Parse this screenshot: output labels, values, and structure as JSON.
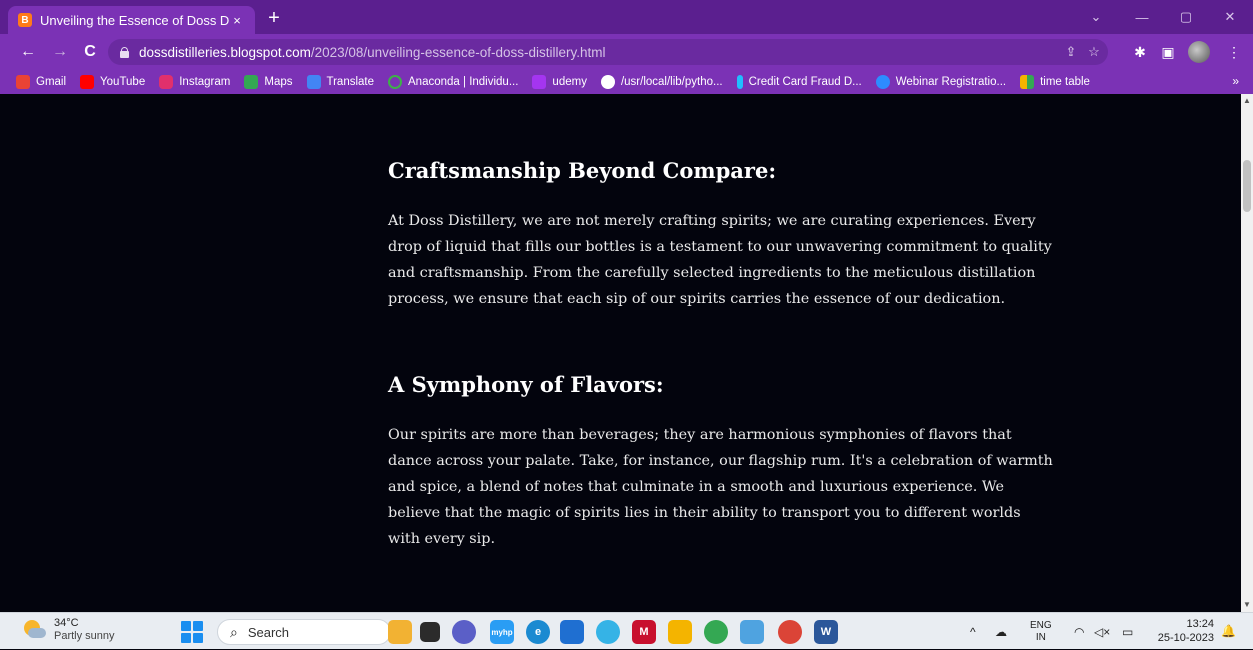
{
  "browser": {
    "tab": {
      "title": "Unveiling the Essence of Doss D",
      "favicon": "B",
      "close": "×"
    },
    "new_tab": "+",
    "window_controls": {
      "dropdown": "⌄",
      "minimize": "—",
      "restore": "▢",
      "close": "✕"
    },
    "nav": {
      "back": "←",
      "forward": "→",
      "reload": "C"
    },
    "url": {
      "host": "dossdistilleries.blogspot.com",
      "path": "/2023/08/unveiling-essence-of-doss-distillery.html"
    },
    "omnibox_icons": {
      "share": "⇪",
      "star": "☆"
    },
    "extensions": {
      "puzzle": "✱",
      "sidepanel": "▣",
      "menu": "⋮"
    },
    "bookmarks": [
      {
        "label": "Gmail",
        "color": "#ea4335"
      },
      {
        "label": "YouTube",
        "color": "#ff0000"
      },
      {
        "label": "Instagram",
        "color": "#e1306c"
      },
      {
        "label": "Maps",
        "color": "#34a853"
      },
      {
        "label": "Translate",
        "color": "#4285f4"
      },
      {
        "label": "Anaconda | Individu...",
        "color": "#3eb049"
      },
      {
        "label": "udemy",
        "color": "#a435f0"
      },
      {
        "label": "/usr/local/lib/pytho...",
        "color": "#ffffff"
      },
      {
        "label": "Credit Card Fraud D...",
        "color": "#20beff"
      },
      {
        "label": "Webinar Registratio...",
        "color": "#2d8cff"
      },
      {
        "label": "time table",
        "color": "#f4b400"
      }
    ],
    "bookmarks_more": "»"
  },
  "article": {
    "sections": [
      {
        "heading": "Craftsmanship Beyond Compare:",
        "body": "At Doss Distillery, we are not merely crafting spirits; we are curating experiences. Every drop of liquid that fills our bottles is a testament to our unwavering commitment to quality and craftsmanship. From the carefully selected ingredients to the meticulous distillation process, we ensure that each sip of our spirits carries the essence of our dedication."
      },
      {
        "heading": "A Symphony of Flavors:",
        "body": "Our spirits are more than beverages; they are harmonious symphonies of flavors that dance across your palate. Take, for instance, our flagship rum. It's a celebration of warmth and spice, a blend of notes that culminate in a smooth and luxurious experience. We believe that the magic of spirits lies in their ability to transport you to different worlds with every sip."
      }
    ]
  },
  "scrollbar": {
    "up": "▲",
    "down": "▼"
  },
  "taskbar": {
    "weather": {
      "temp": "34°C",
      "condition": "Partly sunny"
    },
    "search_label": "Search",
    "search_icon": "⌕",
    "apps": [
      {
        "name": "files-app-icon",
        "color": "#f2b233",
        "glyph": ""
      },
      {
        "name": "taskview-icon",
        "color": "#2b2b2b",
        "glyph": ""
      },
      {
        "name": "chat-app-icon",
        "color": "#5b5fc7",
        "glyph": ""
      },
      {
        "name": "myhp-app-icon",
        "color": "#2a9df4",
        "glyph": "myhp"
      },
      {
        "name": "edge-app-icon",
        "color": "#1b8ad1",
        "glyph": "e"
      },
      {
        "name": "store-app-icon",
        "color": "#1f6fd1",
        "glyph": ""
      },
      {
        "name": "copilot-app-icon",
        "color": "#35b3e6",
        "glyph": ""
      },
      {
        "name": "mcafee-app-icon",
        "color": "#c8102e",
        "glyph": "M"
      },
      {
        "name": "explorer-app-icon",
        "color": "#f4b400",
        "glyph": ""
      },
      {
        "name": "chrome-profile-app-icon",
        "color": "#34a853",
        "glyph": ""
      },
      {
        "name": "notepad-app-icon",
        "color": "#4fa3e0",
        "glyph": ""
      },
      {
        "name": "chrome-app-icon",
        "color": "#db4437",
        "glyph": ""
      },
      {
        "name": "word-app-icon",
        "color": "#2b579a",
        "glyph": "W"
      }
    ],
    "tray": {
      "chevron": "^",
      "onedrive": "☁",
      "lang_top": "ENG",
      "lang_bottom": "IN",
      "wifi": "◠",
      "volume": "◁×",
      "battery": "▭"
    },
    "clock": {
      "time": "13:24",
      "date": "25-10-2023"
    },
    "bell": "🔔"
  }
}
